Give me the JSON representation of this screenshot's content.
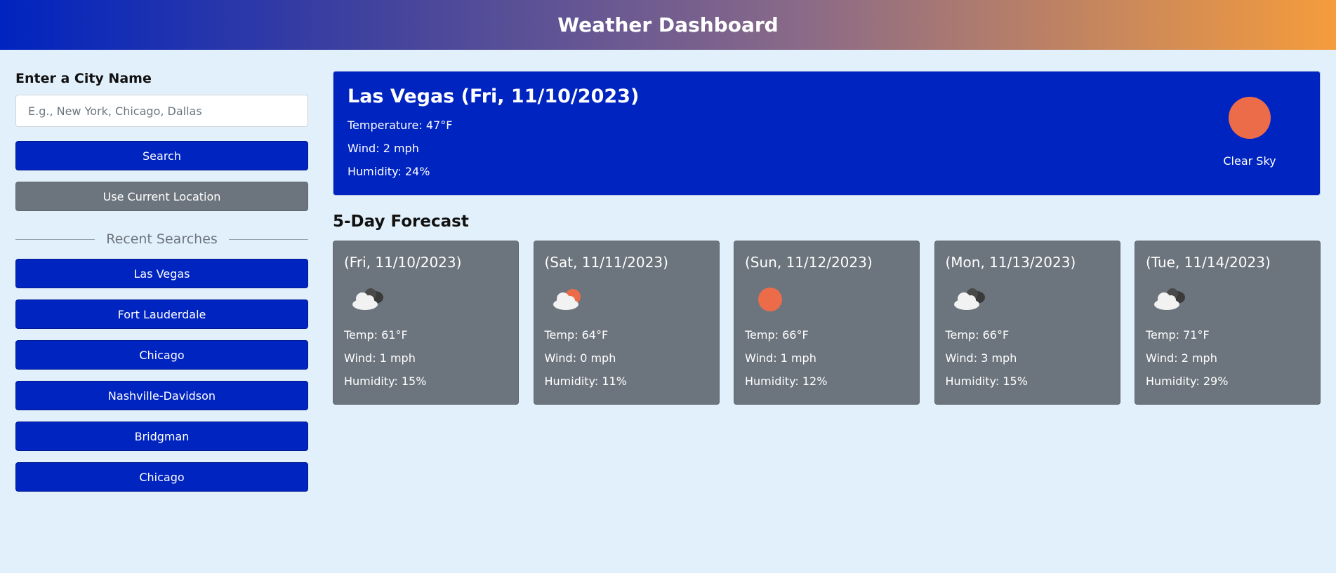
{
  "header": {
    "title": "Weather Dashboard"
  },
  "search": {
    "heading": "Enter a City Name",
    "placeholder": "E.g., New York, Chicago, Dallas",
    "search_label": "Search",
    "location_label": "Use Current Location"
  },
  "recent": {
    "heading": "Recent Searches",
    "items": [
      {
        "label": "Las Vegas"
      },
      {
        "label": "Fort Lauderdale"
      },
      {
        "label": "Chicago"
      },
      {
        "label": "Nashville-Davidson"
      },
      {
        "label": "Bridgman"
      },
      {
        "label": "Chicago"
      }
    ]
  },
  "current": {
    "title": "Las Vegas (Fri, 11/10/2023)",
    "temperature": "Temperature: 47°F",
    "wind": "Wind: 2 mph",
    "humidity": "Humidity: 24%",
    "icon": "sun-icon",
    "description": "Clear Sky"
  },
  "forecast": {
    "heading": "5-Day Forecast",
    "days": [
      {
        "date": "(Fri, 11/10/2023)",
        "icon": "broken-clouds-icon",
        "temp": "Temp: 61°F",
        "wind": "Wind: 1 mph",
        "humidity": "Humidity: 15%"
      },
      {
        "date": "(Sat, 11/11/2023)",
        "icon": "few-clouds-icon",
        "temp": "Temp: 64°F",
        "wind": "Wind: 0 mph",
        "humidity": "Humidity: 11%"
      },
      {
        "date": "(Sun, 11/12/2023)",
        "icon": "sun-icon",
        "temp": "Temp: 66°F",
        "wind": "Wind: 1 mph",
        "humidity": "Humidity: 12%"
      },
      {
        "date": "(Mon, 11/13/2023)",
        "icon": "broken-clouds-icon",
        "temp": "Temp: 66°F",
        "wind": "Wind: 3 mph",
        "humidity": "Humidity: 15%"
      },
      {
        "date": "(Tue, 11/14/2023)",
        "icon": "broken-clouds-icon",
        "temp": "Temp: 71°F",
        "wind": "Wind: 2 mph",
        "humidity": "Humidity: 29%"
      }
    ]
  },
  "colors": {
    "primary": "#0024c0",
    "secondary": "#6c757d",
    "sun": "#ec6c4a",
    "background": "#e2f0fb"
  }
}
